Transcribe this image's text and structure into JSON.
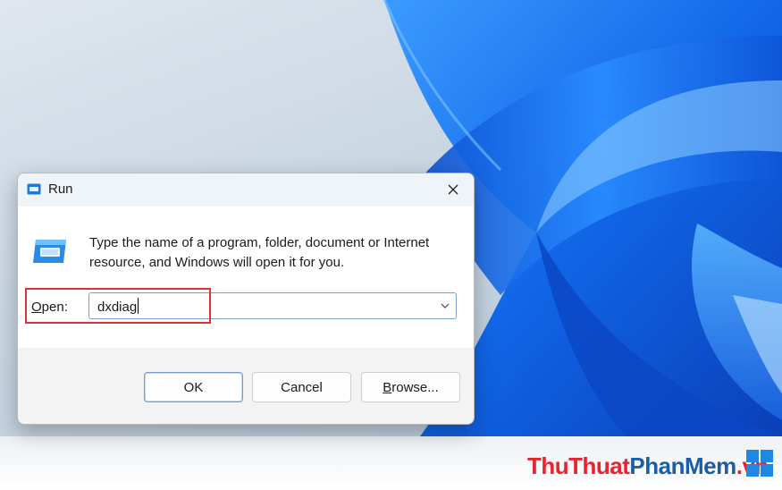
{
  "dialog": {
    "title": "Run",
    "description": "Type the name of a program, folder, document or Internet resource, and Windows will open it for you.",
    "open_label_key": "O",
    "open_label_rest": "pen:",
    "open_value": "dxdiag",
    "buttons": {
      "ok": "OK",
      "cancel": "Cancel",
      "browse_key": "B",
      "browse_rest": "rowse..."
    }
  },
  "watermark": {
    "part1": "ThuThuat",
    "part2": "PhanMem",
    "part3": ".vn"
  },
  "colors": {
    "highlight": "#e0303a",
    "wallpaper_blue": "#1e6fe6",
    "watermark_red": "#e8232b",
    "watermark_blue": "#1b5ea8"
  },
  "icons": [
    "run-icon",
    "close-icon",
    "chevron-down-icon",
    "windows-logo-icon"
  ]
}
